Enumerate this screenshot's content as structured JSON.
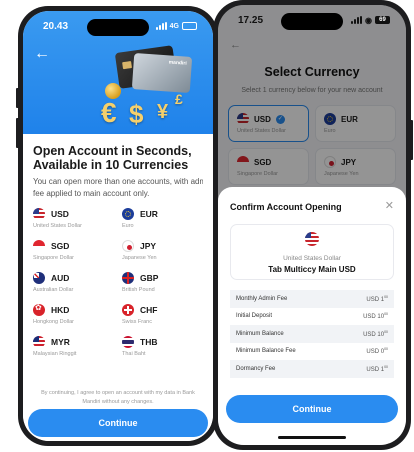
{
  "left": {
    "status": {
      "time": "20.43",
      "network": "4G"
    },
    "hero": {
      "symbols": [
        "€",
        "$",
        "¥",
        "£"
      ],
      "card_logo": "mandiri"
    },
    "heading": "Open Account in Seconds, Available in 10 Currencies",
    "description": "You can open more than one accounts, with admi",
    "description2": "fee applied to main account only.",
    "currencies": [
      {
        "code": "USD",
        "name": "United States Dollar",
        "flag": "us-flag"
      },
      {
        "code": "EUR",
        "name": "Euro",
        "flag": "eu-flag"
      },
      {
        "code": "SGD",
        "name": "Singapore Dollar",
        "flag": "sg-flag"
      },
      {
        "code": "JPY",
        "name": "Japanese Yen",
        "flag": "jp-flag"
      },
      {
        "code": "AUD",
        "name": "Australian Dollar",
        "flag": "au-flag"
      },
      {
        "code": "GBP",
        "name": "British Pound",
        "flag": "gb-flag"
      },
      {
        "code": "HKD",
        "name": "Hongkong Dollar",
        "flag": "hk-flag"
      },
      {
        "code": "CHF",
        "name": "Swiss Franc",
        "flag": "ch-flag"
      },
      {
        "code": "MYR",
        "name": "Malaysian Ringgit",
        "flag": "my-flag"
      },
      {
        "code": "THB",
        "name": "Thai Baht",
        "flag": "th-flag"
      }
    ],
    "consent": "By continuing, I agree to open an account with my data in Bank Mandiri without any changes.",
    "continue_label": "Continue"
  },
  "right": {
    "status": {
      "time": "17.25",
      "battery": "69"
    },
    "title": "Select Currency",
    "subtitle": "Select 1 currency below for your new account",
    "options": [
      {
        "code": "USD",
        "name": "United States Dollar",
        "selected": true
      },
      {
        "code": "EUR",
        "name": "Euro",
        "selected": false
      },
      {
        "code": "SGD",
        "name": "Singapore Dollar",
        "selected": false
      },
      {
        "code": "JPY",
        "name": "Japanese Yen",
        "selected": false
      }
    ],
    "sheet": {
      "title": "Confirm Account Opening",
      "currency_name": "United States Dollar",
      "account_name": "Tab Multiccy Main USD",
      "fees": [
        {
          "label": "Monthly Admin Fee",
          "value": "USD 1",
          "sup": "00"
        },
        {
          "label": "Initial Deposit",
          "value": "USD 10",
          "sup": "00"
        },
        {
          "label": "Minimum Balance",
          "value": "USD 10",
          "sup": "00"
        },
        {
          "label": "Minimum Balance Fee",
          "value": "USD 0",
          "sup": "00"
        },
        {
          "label": "Dormancy Fee",
          "value": "USD 1",
          "sup": "00"
        }
      ],
      "continue_label": "Continue"
    }
  },
  "colors": {
    "accent": "#2a8cf0",
    "hero": "#1f82ea"
  }
}
